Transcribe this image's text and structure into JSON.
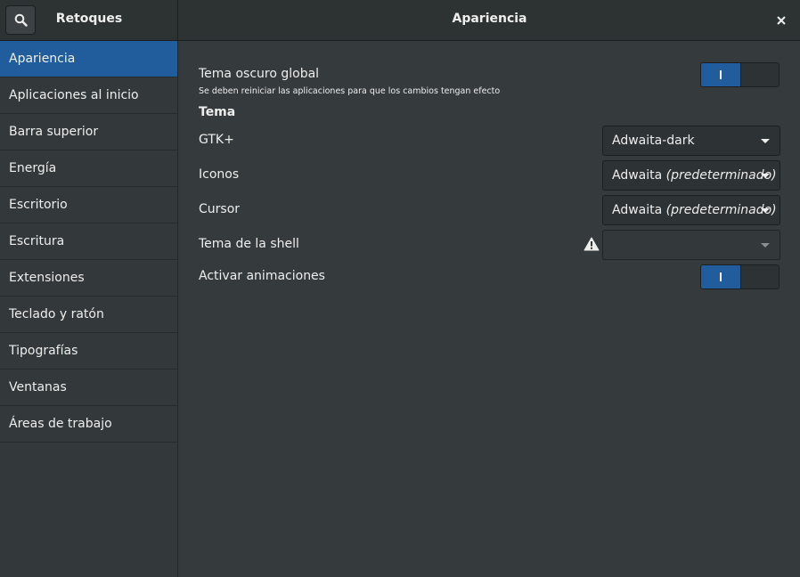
{
  "header": {
    "app_title": "Retoques",
    "page_title": "Apariencia"
  },
  "sidebar": {
    "items": [
      {
        "label": "Apariencia",
        "active": true
      },
      {
        "label": "Aplicaciones al inicio"
      },
      {
        "label": "Barra superior"
      },
      {
        "label": "Energía"
      },
      {
        "label": "Escritorio"
      },
      {
        "label": "Escritura"
      },
      {
        "label": "Extensiones"
      },
      {
        "label": "Teclado y ratón"
      },
      {
        "label": "Tipografías"
      },
      {
        "label": "Ventanas"
      },
      {
        "label": "Áreas de trabajo"
      }
    ]
  },
  "main": {
    "dark_theme": {
      "label": "Tema oscuro global",
      "subtitle": "Se deben reiniciar las aplicaciones para que los cambios tengan efecto",
      "enabled": true
    },
    "theme_section": "Tema",
    "gtk": {
      "label": "GTK+",
      "value": "Adwaita-dark"
    },
    "icons": {
      "label": "Iconos",
      "value": "Adwaita",
      "value_note": "(predeterminado)"
    },
    "cursor": {
      "label": "Cursor",
      "value": "Adwaita",
      "value_note": "(predeterminado)"
    },
    "shell": {
      "label": "Tema de la shell",
      "value": ""
    },
    "animations": {
      "label": "Activar animaciones",
      "enabled": true
    }
  },
  "colors": {
    "accent": "#215d9c",
    "background": "#353b3d",
    "headerbar": "#2d3233"
  },
  "icons": [
    "search-icon",
    "close-icon",
    "warning-icon",
    "dropdown-arrow-icon"
  ]
}
